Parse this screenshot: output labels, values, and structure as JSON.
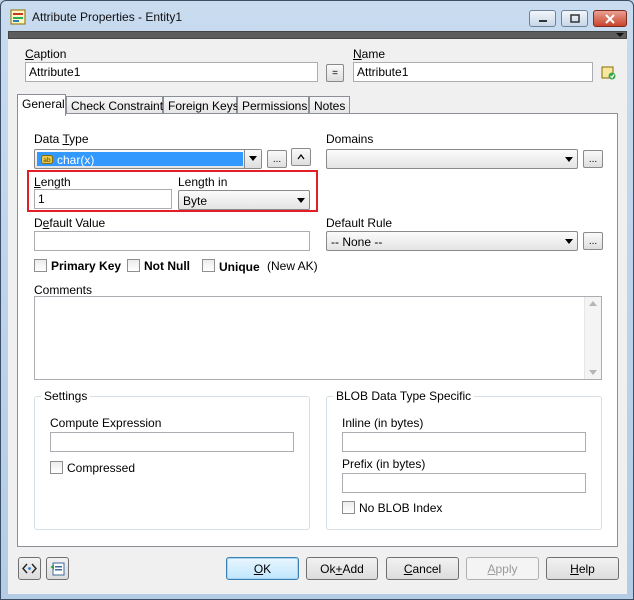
{
  "window": {
    "title": "Attribute Properties - Entity1"
  },
  "header": {
    "caption_label": "Caption",
    "caption_value": "Attribute1",
    "equals_label": "=",
    "name_label": "Name",
    "name_value": "Attribute1"
  },
  "tabs": [
    {
      "label": "General"
    },
    {
      "label": "Check Constraints"
    },
    {
      "label": "Foreign Keys"
    },
    {
      "label": "Permissions"
    },
    {
      "label": "Notes"
    }
  ],
  "general": {
    "data_type_label": "Data Type",
    "data_type_value": "char(x)",
    "ellipsis": "...",
    "domains_label": "Domains",
    "length_label": "Length",
    "length_value": "1",
    "length_in_label": "Length in",
    "length_in_value": "Byte",
    "default_value_label": "Default Value",
    "default_value": "",
    "default_rule_label": "Default Rule",
    "default_rule_value": "-- None --",
    "primary_key_label": "Primary Key",
    "not_null_label": "Not Null",
    "unique_label": "Unique",
    "new_ak_label": "(New AK)",
    "comments_label": "Comments",
    "comments_value": ""
  },
  "settings": {
    "title": "Settings",
    "compute_expression_label": "Compute Expression",
    "compute_expression_value": "",
    "compressed_label": "Compressed"
  },
  "blob": {
    "title": "BLOB Data Type Specific",
    "inline_label": "Inline (in bytes)",
    "inline_value": "",
    "prefix_label": "Prefix (in bytes)",
    "prefix_value": "",
    "no_blob_index_label": "No BLOB Index"
  },
  "buttons": {
    "ok": "OK",
    "ok_add": "Ok+Add",
    "cancel": "Cancel",
    "apply": "Apply",
    "help": "Help"
  },
  "colors": {
    "highlight_border": "#e21f26",
    "selection_blue": "#3399ff"
  }
}
